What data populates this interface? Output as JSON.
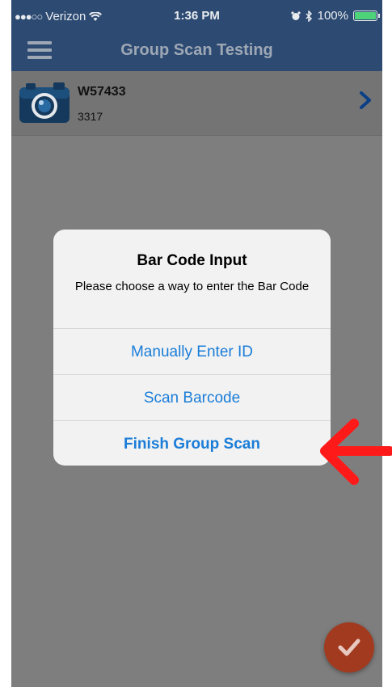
{
  "status_bar": {
    "carrier": "Verizon",
    "time": "1:36 PM",
    "battery": "100%"
  },
  "nav": {
    "title": "Group Scan Testing"
  },
  "list": {
    "items": [
      {
        "title": "W57433",
        "subtitle": "3317"
      }
    ]
  },
  "dialog": {
    "title": "Bar Code Input",
    "message": "Please choose a way to enter the Bar Code",
    "buttons": [
      {
        "label": "Manually Enter ID"
      },
      {
        "label": "Scan Barcode"
      },
      {
        "label": "Finish Group Scan"
      }
    ]
  },
  "colors": {
    "nav_blue": "#2d4a73",
    "link_blue": "#1a7dd8",
    "fab": "#a23a1f",
    "arrow": "#ff1a1a"
  }
}
